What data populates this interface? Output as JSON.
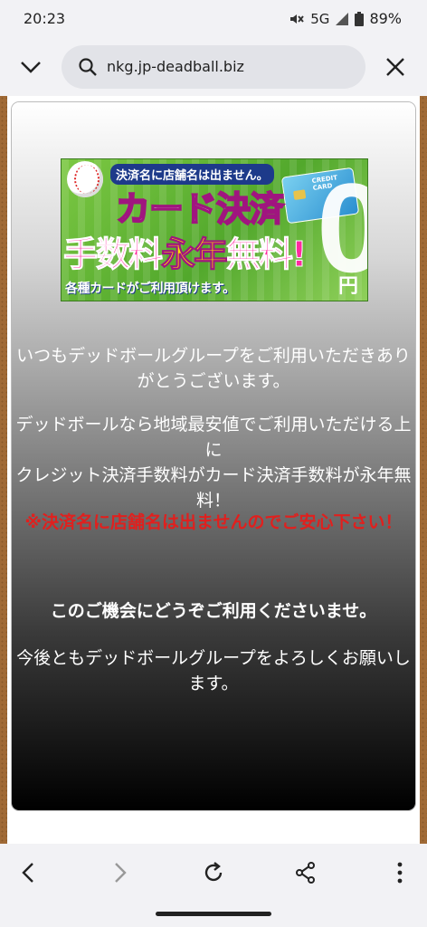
{
  "status": {
    "time": "20:23",
    "network": "5G",
    "battery": "89%"
  },
  "browser": {
    "url": "nkg.jp-deadball.biz"
  },
  "banner": {
    "top": "決済名に店舗名は出ません。",
    "title": "カード決済",
    "line2_a": "手数料",
    "line2_b": "永年",
    "line2_c": "無料!",
    "bottom": "各種カードがご利用頂けます。",
    "zero": "0",
    "yen": "円",
    "card_text": "CREDIT CARD"
  },
  "content": {
    "p1": "いつもデッドボールグループをご利用いただきありがとうございます。",
    "p2": "デッドボールなら地域最安値でご利用いただける上に",
    "p3": "クレジット決済手数料がカード決済手数料が永年無料！",
    "p4": "※決済名に店舗名は出ませんのでご安心下さい！",
    "p5": "このご機会にどうぞご利用くださいませ。",
    "p6": "今後ともデッドボールグループをよろしくお願いします。"
  }
}
